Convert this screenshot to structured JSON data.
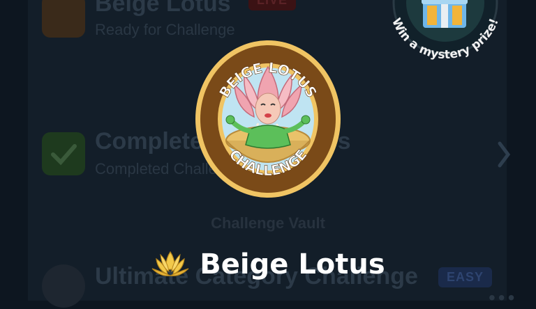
{
  "background_list": {
    "row1": {
      "title": "Beige Lotus",
      "subtitle": "Ready for Challenge",
      "badge": "LIVE"
    },
    "row2": {
      "title": "Completed Challenges",
      "subtitle": "Completed Challenges"
    },
    "vault_label": "Challenge Vault",
    "row3": {
      "title": "Ultimate Category Challenge",
      "badge": "EASY"
    }
  },
  "prize": {
    "text": "Win a mystery prize!",
    "icon": "gift-box-icon"
  },
  "emblem": {
    "top_text": "BEIGE LOTUS",
    "bottom_text": "CHALLENGE"
  },
  "title": {
    "label": "Beige Lotus",
    "icon": "lotus-icon"
  },
  "colors": {
    "background": "#0d1620",
    "emblem_ring": "#7a4a18",
    "emblem_gold": "#f0c463",
    "title_text": "#ffffff"
  }
}
